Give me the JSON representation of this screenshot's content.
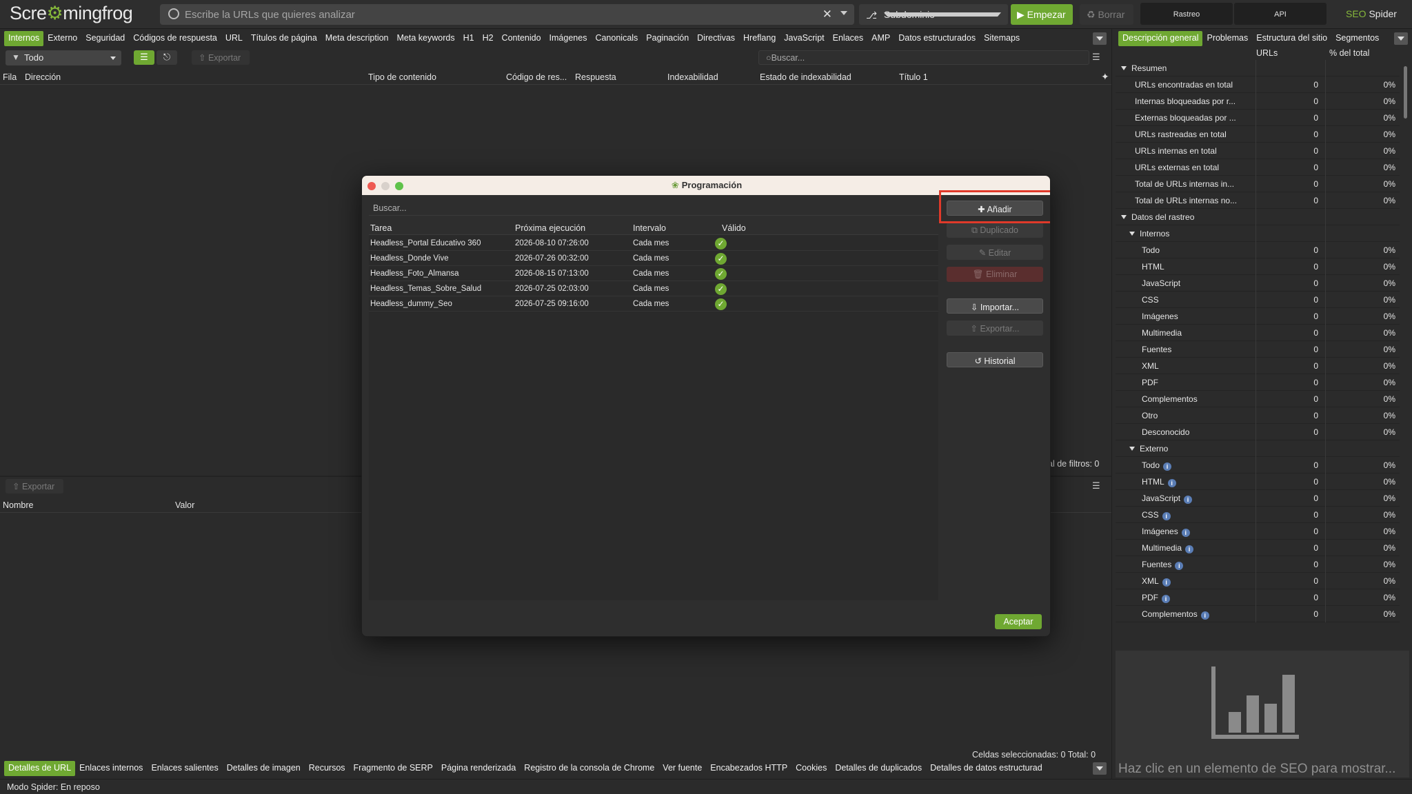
{
  "app": {
    "logo_text_a": "Scre",
    "logo_text_b": "mingfrog",
    "url_placeholder": "Escribe la URLs que quieres analizar",
    "clear_symbol": "✕",
    "mode": "Subdominio",
    "start_label": "Empezar",
    "clear_label": "Borrar",
    "rastreo_label": "Rastreo",
    "api_label": "API",
    "brand_a": "SEO",
    "brand_b": " Spider",
    "accent_color": "#6fa832"
  },
  "main_tabs": [
    "Internos",
    "Externo",
    "Seguridad",
    "Códigos de respuesta",
    "URL",
    "Títulos de página",
    "Meta description",
    "Meta keywords",
    "H1",
    "H2",
    "Contenido",
    "Imágenes",
    "Canonicals",
    "Paginación",
    "Directivas",
    "Hreflang",
    "JavaScript",
    "Enlaces",
    "AMP",
    "Datos estructurados",
    "Sitemaps"
  ],
  "toolbar": {
    "filter_value": "Todo",
    "export_label": "Exportar",
    "search_placeholder": "Buscar..."
  },
  "grid": {
    "columns": [
      "Fila",
      "Dirección",
      "Tipo de contenido",
      "Código de res...",
      "Respuesta",
      "Indexabilidad",
      "Estado de indexabilidad",
      "Título 1"
    ],
    "total_filters": "al de filtros: 0"
  },
  "lower": {
    "export_label": "Exportar",
    "columns": [
      "Nombre",
      "Valor"
    ],
    "selected_cells": "Celdas seleccionadas: 0  Total: 0"
  },
  "bottom_tabs": [
    "Detalles de URL",
    "Enlaces internos",
    "Enlaces salientes",
    "Detalles de imagen",
    "Recursos",
    "Fragmento de SERP",
    "Página renderizada",
    "Registro de la consola de Chrome",
    "Ver fuente",
    "Encabezados HTTP",
    "Cookies",
    "Detalles de duplicados",
    "Detalles de datos estructurad"
  ],
  "status": "Modo Spider: En reposo",
  "right_panel": {
    "tabs": [
      "Descripción general",
      "Problemas",
      "Estructura del sitio",
      "Segmentos"
    ],
    "col_urls": "URLs",
    "col_pct": "% del total",
    "rows": [
      {
        "label": "Resumen",
        "type": "section",
        "indent": 0
      },
      {
        "label": "URLs encontradas en total",
        "urls": "0",
        "pct": "0%",
        "indent": 1
      },
      {
        "label": "Internas bloqueadas por r...",
        "urls": "0",
        "pct": "0%",
        "indent": 1
      },
      {
        "label": "Externas bloqueadas por ...",
        "urls": "0",
        "pct": "0%",
        "indent": 1
      },
      {
        "label": "URLs rastreadas en total",
        "urls": "0",
        "pct": "0%",
        "indent": 1
      },
      {
        "label": "URLs internas en total",
        "urls": "0",
        "pct": "0%",
        "indent": 1
      },
      {
        "label": "URLs externas en total",
        "urls": "0",
        "pct": "0%",
        "indent": 1
      },
      {
        "label": "Total de URLs internas in...",
        "urls": "0",
        "pct": "0%",
        "indent": 1
      },
      {
        "label": "Total de URLs internas no...",
        "urls": "0",
        "pct": "0%",
        "indent": 1
      },
      {
        "label": "Datos del rastreo",
        "type": "section",
        "indent": 0
      },
      {
        "label": "Internos",
        "type": "section",
        "indent": 1
      },
      {
        "label": "Todo",
        "urls": "0",
        "pct": "0%",
        "indent": 2
      },
      {
        "label": "HTML",
        "urls": "0",
        "pct": "0%",
        "indent": 2
      },
      {
        "label": "JavaScript",
        "urls": "0",
        "pct": "0%",
        "indent": 2
      },
      {
        "label": "CSS",
        "urls": "0",
        "pct": "0%",
        "indent": 2
      },
      {
        "label": "Imágenes",
        "urls": "0",
        "pct": "0%",
        "indent": 2
      },
      {
        "label": "Multimedia",
        "urls": "0",
        "pct": "0%",
        "indent": 2
      },
      {
        "label": "Fuentes",
        "urls": "0",
        "pct": "0%",
        "indent": 2
      },
      {
        "label": "XML",
        "urls": "0",
        "pct": "0%",
        "indent": 2
      },
      {
        "label": "PDF",
        "urls": "0",
        "pct": "0%",
        "indent": 2
      },
      {
        "label": "Complementos",
        "urls": "0",
        "pct": "0%",
        "indent": 2
      },
      {
        "label": "Otro",
        "urls": "0",
        "pct": "0%",
        "indent": 2
      },
      {
        "label": "Desconocido",
        "urls": "0",
        "pct": "0%",
        "indent": 2
      },
      {
        "label": "Externo",
        "type": "section",
        "indent": 1
      },
      {
        "label": "Todo",
        "urls": "0",
        "pct": "0%",
        "indent": 2,
        "info": true
      },
      {
        "label": "HTML",
        "urls": "0",
        "pct": "0%",
        "indent": 2,
        "info": true
      },
      {
        "label": "JavaScript",
        "urls": "0",
        "pct": "0%",
        "indent": 2,
        "info": true
      },
      {
        "label": "CSS",
        "urls": "0",
        "pct": "0%",
        "indent": 2,
        "info": true
      },
      {
        "label": "Imágenes",
        "urls": "0",
        "pct": "0%",
        "indent": 2,
        "info": true
      },
      {
        "label": "Multimedia",
        "urls": "0",
        "pct": "0%",
        "indent": 2,
        "info": true
      },
      {
        "label": "Fuentes",
        "urls": "0",
        "pct": "0%",
        "indent": 2,
        "info": true
      },
      {
        "label": "XML",
        "urls": "0",
        "pct": "0%",
        "indent": 2,
        "info": true
      },
      {
        "label": "PDF",
        "urls": "0",
        "pct": "0%",
        "indent": 2,
        "info": true
      },
      {
        "label": "Complementos",
        "urls": "0",
        "pct": "0%",
        "indent": 2,
        "info": true
      }
    ],
    "hint": "Haz clic en un elemento de SEO para mostrar..."
  },
  "modal": {
    "title": "Programación",
    "search_placeholder": "Buscar...",
    "columns": [
      "Tarea",
      "Próxima ejecución",
      "Intervalo",
      "Válido"
    ],
    "rows": [
      {
        "task": "Headless_Portal Educativo 360",
        "next": "2026-08-10 07:26:00",
        "interval": "Cada mes",
        "valid": true
      },
      {
        "task": "Headless_Donde Vive",
        "next": "2026-07-26 00:32:00",
        "interval": "Cada mes",
        "valid": true
      },
      {
        "task": "Headless_Foto_Almansa",
        "next": "2026-08-15 07:13:00",
        "interval": "Cada mes",
        "valid": true
      },
      {
        "task": "Headless_Temas_Sobre_Salud",
        "next": "2026-07-25 02:03:00",
        "interval": "Cada mes",
        "valid": true
      },
      {
        "task": "Headless_dummy_Seo",
        "next": "2026-07-25 09:16:00",
        "interval": "Cada mes",
        "valid": true
      }
    ],
    "buttons": {
      "add": "Añadir",
      "duplicate": "Duplicado",
      "edit": "Editar",
      "delete": "Eliminar",
      "import": "Importar...",
      "export": "Exportar...",
      "history": "Historial"
    },
    "accept": "Aceptar",
    "highlight_color": "#e03a2a"
  }
}
